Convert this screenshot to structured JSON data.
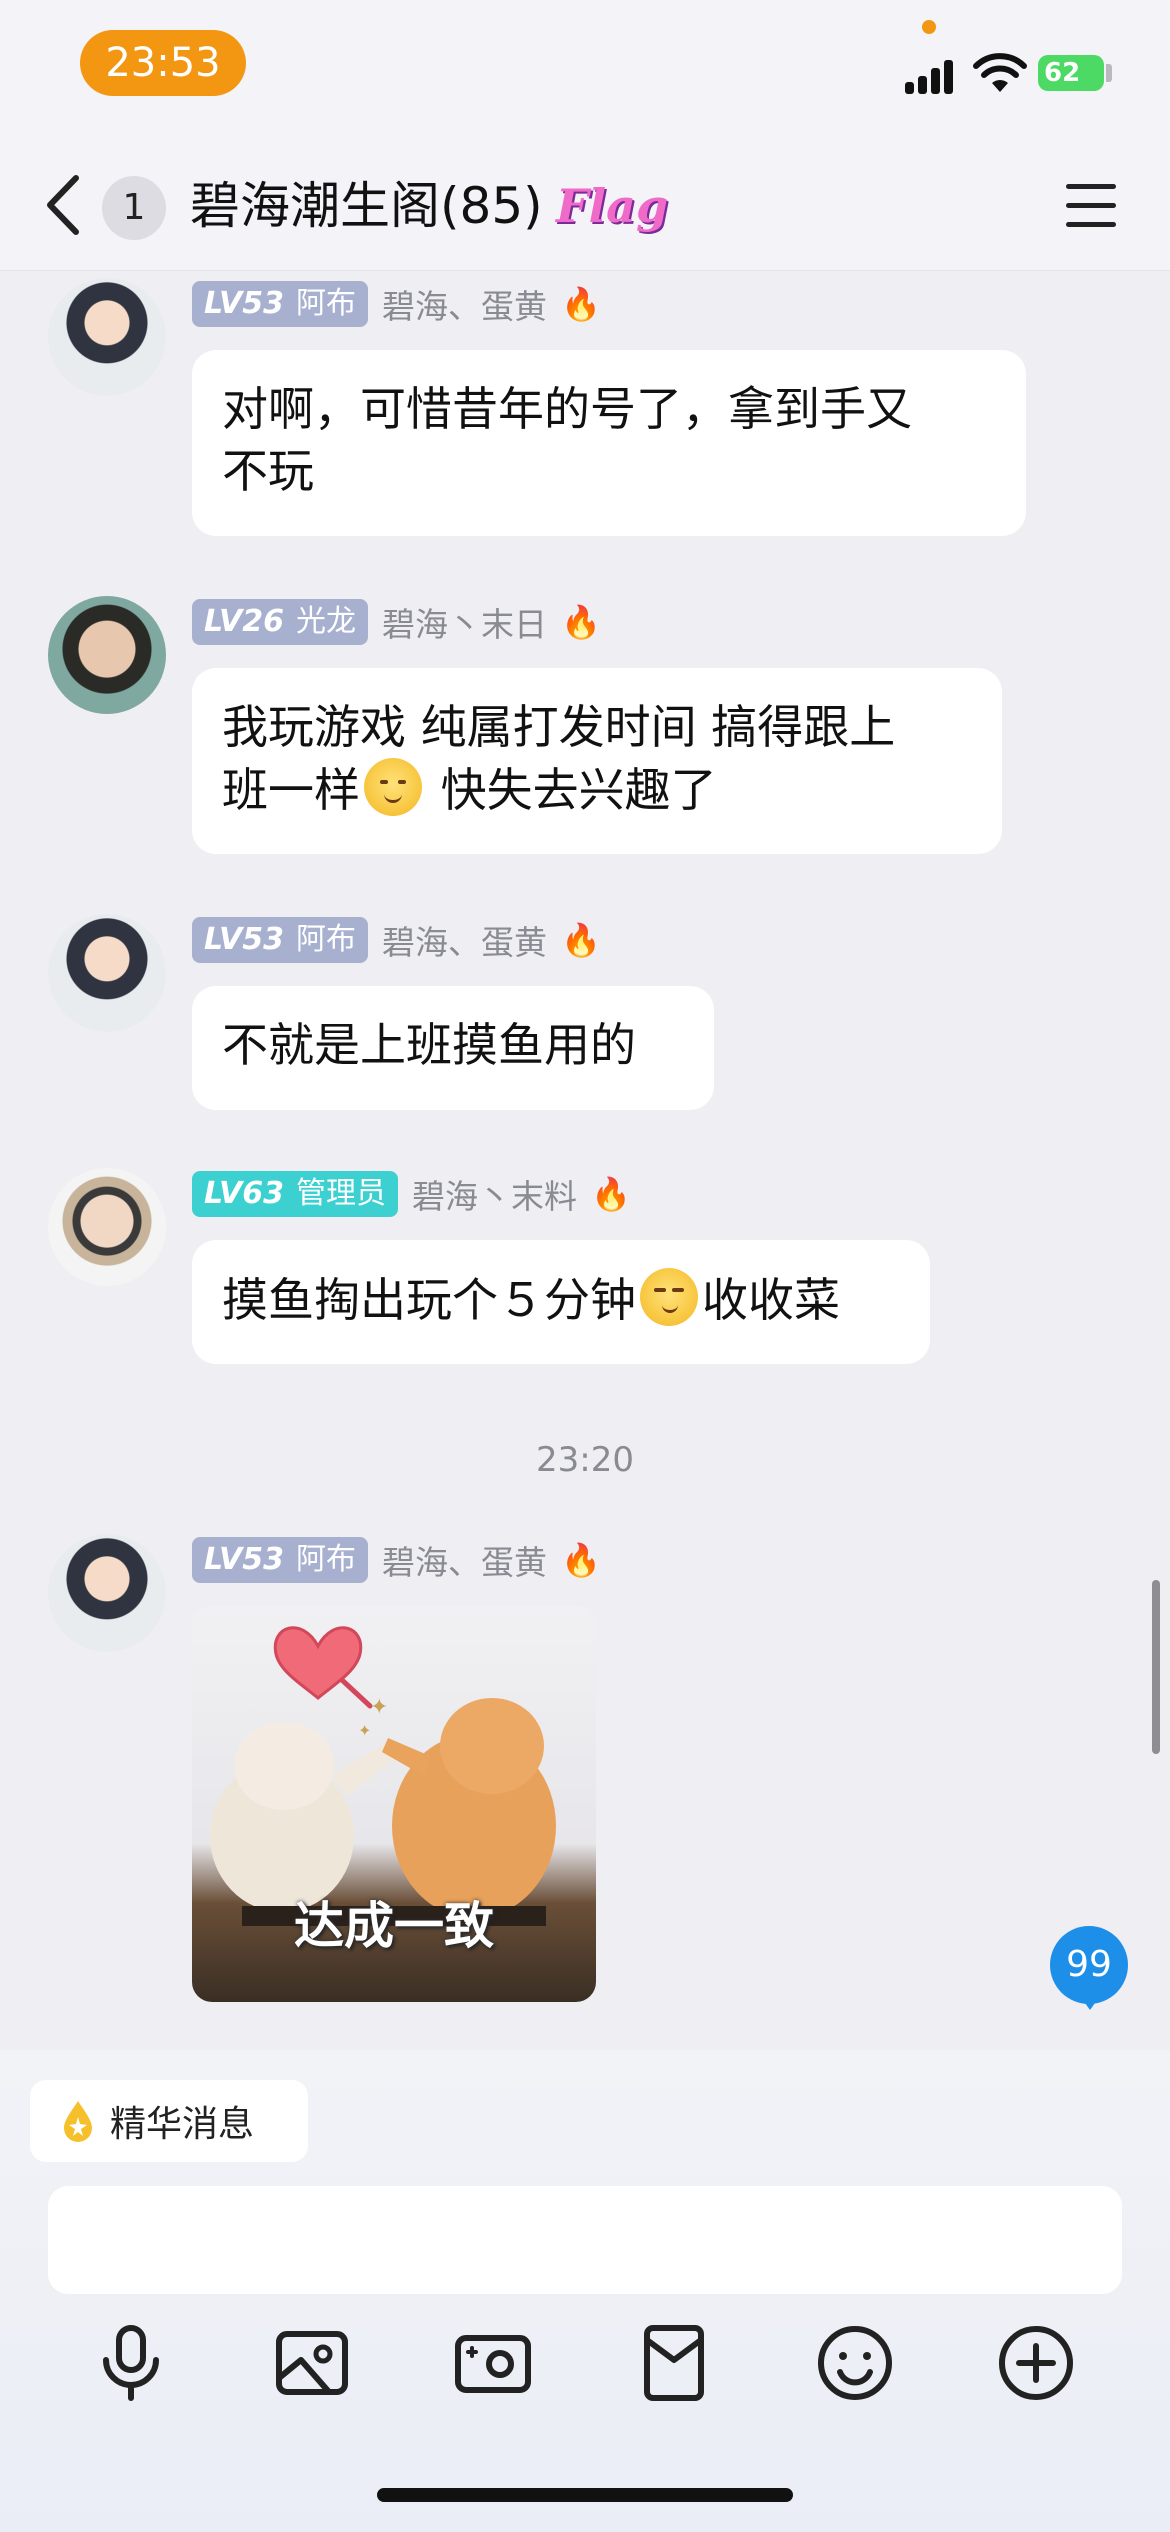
{
  "status_bar": {
    "time": "23:53",
    "battery": "62"
  },
  "nav": {
    "unread_count": "1",
    "title": "碧海潮生阁(85)",
    "flag_label": "Flag"
  },
  "messages": [
    {
      "level": "LV53",
      "title": "阿布",
      "nickname": "碧海、蛋黄",
      "text_lines": [
        "对啊，可惜昔年的号了，拿到手又",
        "不玩"
      ]
    },
    {
      "level": "LV26",
      "title": "光龙",
      "nickname": "碧海丶末日",
      "text_line1": "我玩游戏 纯属打发时间 搞得跟上",
      "text_line2_pre": "班一样",
      "text_line2_post": " 快失去兴趣了"
    },
    {
      "level": "LV53",
      "title": "阿布",
      "nickname": "碧海、蛋黄",
      "text": "不就是上班摸鱼用的"
    },
    {
      "level": "LV63",
      "title": "管理员",
      "nickname": "碧海丶末料",
      "text_pre": "摸鱼掏出玩个５分钟",
      "text_post": "收收菜"
    },
    {
      "level": "LV53",
      "title": "阿布",
      "nickname": "碧海、蛋黄",
      "sticker_caption": "达成一致"
    }
  ],
  "timestamp": "23:20",
  "unread_badge": "99",
  "essence": {
    "label": "精华消息"
  },
  "input": {
    "placeholder": ""
  },
  "toolbar": [
    "microphone-icon",
    "image-icon",
    "camera-icon",
    "red-packet-icon",
    "emoji-icon",
    "plus-icon"
  ],
  "colors": {
    "accent": "#f39612",
    "level_badge": "#a8b0cf",
    "admin_badge": "#3cd1d0",
    "unread_blue": "#1e8fe9"
  }
}
